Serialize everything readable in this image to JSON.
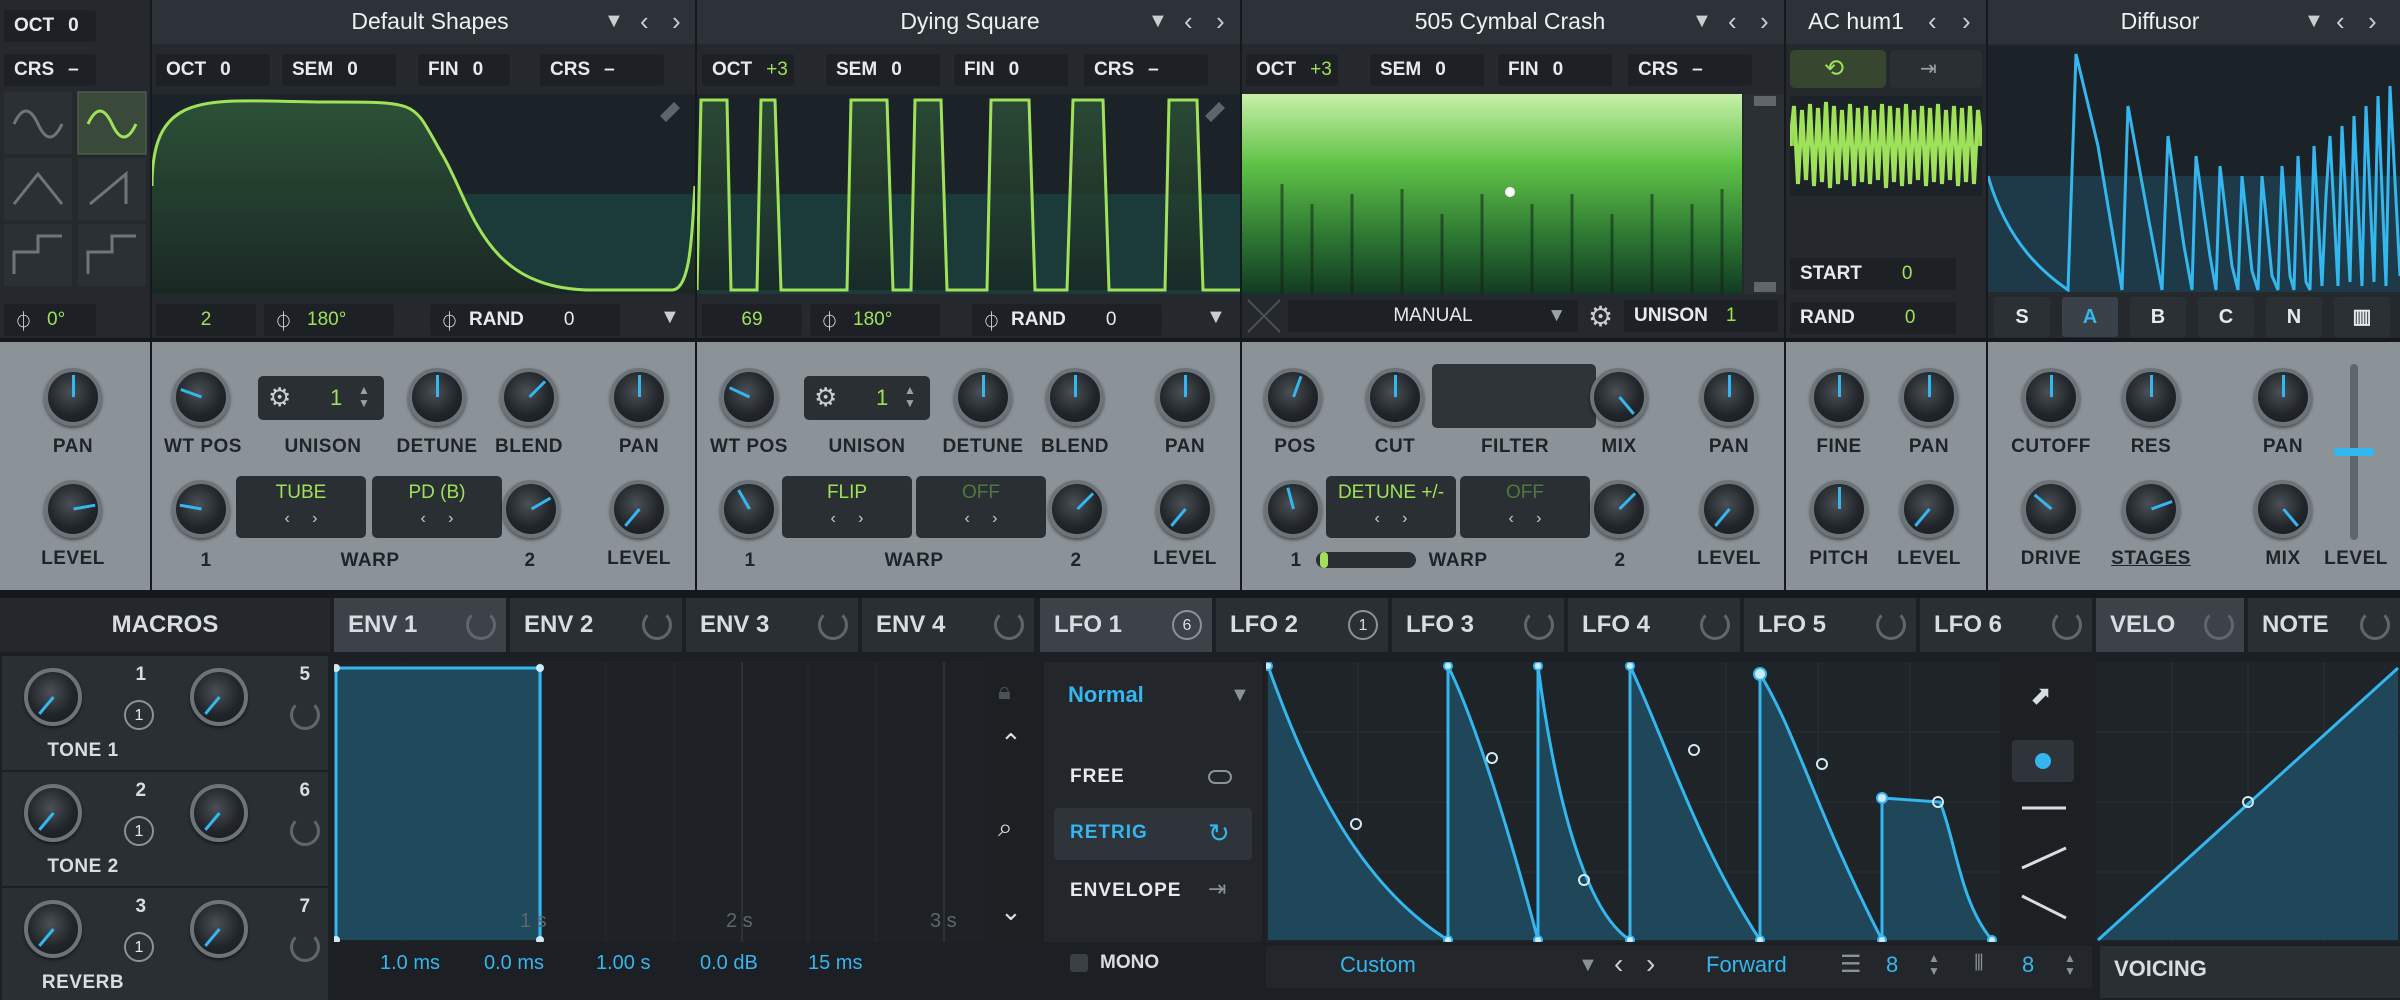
{
  "colors": {
    "accent_green": "#9fe25a",
    "accent_blue": "#34b6ee",
    "panel_grey": "#8b9399",
    "panel_dark": "#25292e"
  },
  "noise": {
    "oct_label": "OCT",
    "oct_value": "0",
    "crs_label": "CRS",
    "crs_value": "–",
    "phase_value": "0°"
  },
  "osc1": {
    "name": "Default Shapes",
    "oct_label": "OCT",
    "oct": "0",
    "sem_label": "SEM",
    "sem": "0",
    "fin_label": "FIN",
    "fin": "0",
    "crs_label": "CRS",
    "crs": "–",
    "frame": "2",
    "phase": "180°",
    "rand_label": "RAND",
    "rand": "0",
    "unison": "1",
    "knob_labels": {
      "pan": "PAN",
      "level": "LEVEL",
      "wt_pos": "WT POS",
      "unison": "UNISON",
      "detune": "DETUNE",
      "blend": "BLEND",
      "pan2": "PAN",
      "level2": "LEVEL"
    },
    "warp1": "TUBE",
    "warp2": "PD (B)",
    "warp_label": "WARP",
    "warp_n1": "1",
    "warp_n2": "2"
  },
  "osc2": {
    "name": "Dying Square",
    "oct_label": "OCT",
    "oct": "+3",
    "sem_label": "SEM",
    "sem": "0",
    "fin_label": "FIN",
    "fin": "0",
    "crs_label": "CRS",
    "crs": "–",
    "frame": "69",
    "phase": "180°",
    "rand_label": "RAND",
    "rand": "0",
    "unison": "1",
    "knob_labels": {
      "wt_pos": "WT POS",
      "unison": "UNISON",
      "detune": "DETUNE",
      "blend": "BLEND",
      "pan": "PAN",
      "level": "LEVEL"
    },
    "warp1": "FLIP",
    "warp2": "OFF",
    "warp_label": "WARP",
    "warp_n1": "1",
    "warp_n2": "2"
  },
  "sampler": {
    "name": "505 Cymbal Crash",
    "oct_label": "OCT",
    "oct": "+3",
    "sem_label": "SEM",
    "sem": "0",
    "fin_label": "FIN",
    "fin": "0",
    "crs_label": "CRS",
    "crs": "–",
    "mode": "MANUAL",
    "unison_label": "UNISON",
    "unison": "1",
    "knob_labels": {
      "pos": "POS",
      "cut": "CUT",
      "filter": "FILTER",
      "mix": "MIX",
      "pan": "PAN",
      "level": "LEVEL"
    },
    "warp1": "DETUNE +/-",
    "warp2": "OFF",
    "warp_label": "WARP",
    "warp_n1": "1",
    "warp_n2": "2"
  },
  "noise_osc": {
    "name": "AC hum1",
    "start_label": "START",
    "start": "0",
    "rand_label": "RAND",
    "rand": "0",
    "knob_labels": {
      "fine": "FINE",
      "pan": "PAN",
      "pitch": "PITCH",
      "level": "LEVEL"
    }
  },
  "filter": {
    "name": "Diffusor",
    "modes": [
      "S",
      "A",
      "B",
      "C",
      "N"
    ],
    "selected_mode": "A",
    "knob_labels": {
      "cutoff": "CUTOFF",
      "res": "RES",
      "pan": "PAN",
      "drive": "DRIVE",
      "stages": "STAGES",
      "mix": "MIX",
      "level": "LEVEL"
    }
  },
  "macros": {
    "title": "MACROS",
    "items": [
      {
        "num": "1",
        "badge": "1",
        "name": "TONE 1"
      },
      {
        "num": "5",
        "badge": "",
        "name": ""
      },
      {
        "num": "2",
        "badge": "1",
        "name": "TONE 2"
      },
      {
        "num": "6",
        "badge": "",
        "name": ""
      },
      {
        "num": "3",
        "badge": "1",
        "name": "REVERB"
      },
      {
        "num": "7",
        "badge": "",
        "name": ""
      }
    ]
  },
  "env_tabs": [
    "ENV 1",
    "ENV 2",
    "ENV 3",
    "ENV 4"
  ],
  "lfo_tabs": [
    {
      "label": "LFO 1",
      "badge": "6"
    },
    {
      "label": "LFO 2",
      "badge": "1"
    },
    {
      "label": "LFO 3",
      "badge": ""
    },
    {
      "label": "LFO 4",
      "badge": ""
    },
    {
      "label": "LFO 5",
      "badge": ""
    },
    {
      "label": "LFO 6",
      "badge": ""
    }
  ],
  "mod_tabs": [
    "VELO",
    "NOTE"
  ],
  "env": {
    "time_labels": [
      "1 s",
      "2 s",
      "3 s"
    ],
    "values": [
      "1.0 ms",
      "0.0 ms",
      "1.00 s",
      "0.0 dB",
      "15 ms"
    ]
  },
  "lfo": {
    "mode": "Normal",
    "trigger_options": [
      "FREE",
      "RETRIG",
      "ENVELOPE"
    ],
    "selected_trigger": "RETRIG",
    "mono_label": "MONO",
    "shape": "Custom",
    "direction": "Forward",
    "grid_x": "8",
    "grid_y": "8"
  },
  "voicing": {
    "label": "VOICING"
  }
}
